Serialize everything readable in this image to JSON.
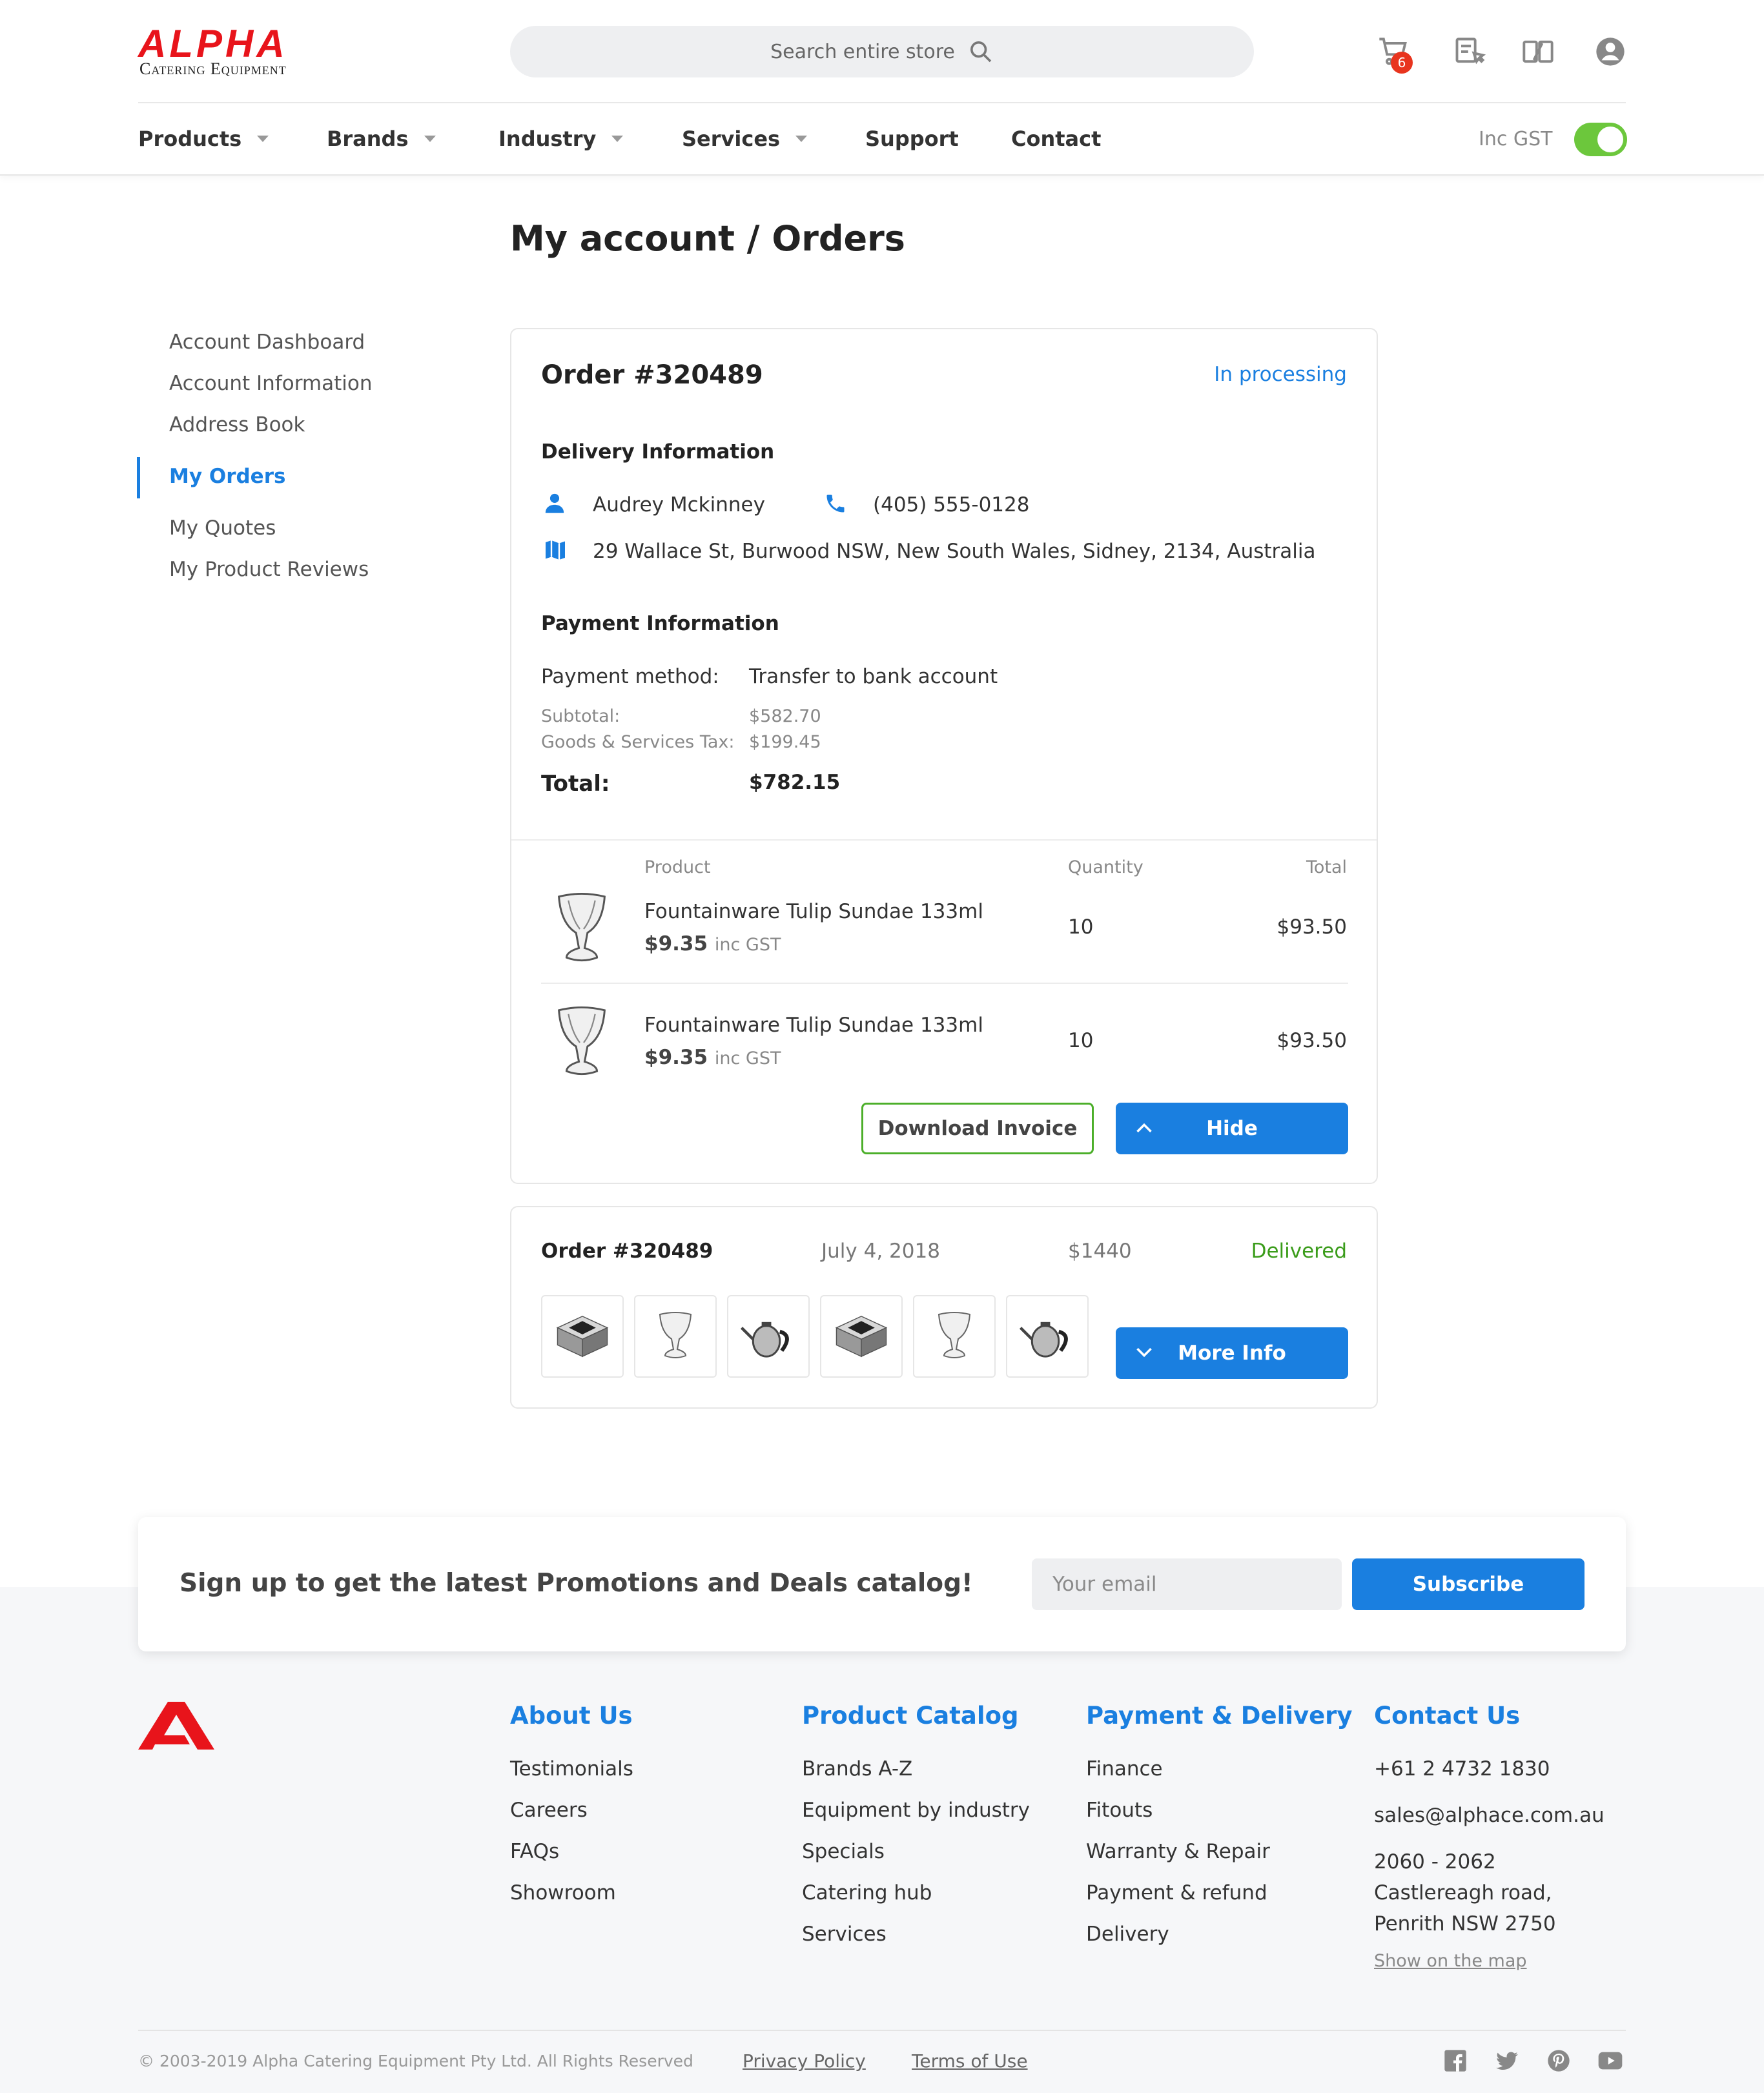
{
  "brand": {
    "name": "ALPHA",
    "tagline": "Catering Equipment",
    "accent": "#e8141b"
  },
  "colors": {
    "primary": "#1a7fe0",
    "success": "#4caf2a",
    "delivered": "#3a9c1a",
    "toggle_on": "#6cc73c"
  },
  "search": {
    "placeholder": "Search entire store"
  },
  "header": {
    "cart_count": "6",
    "icons": [
      "cart-icon",
      "quote-list-icon",
      "compare-icon",
      "user-account-icon"
    ]
  },
  "nav": {
    "items": [
      {
        "label": "Products",
        "dropdown": true
      },
      {
        "label": "Brands",
        "dropdown": true
      },
      {
        "label": "Industry",
        "dropdown": true
      },
      {
        "label": "Services",
        "dropdown": true
      },
      {
        "label": "Support",
        "dropdown": false
      },
      {
        "label": "Contact",
        "dropdown": false
      }
    ],
    "gst_label": "Inc GST",
    "gst_toggle_on": true
  },
  "page": {
    "title": "My account / Orders"
  },
  "sidebar": {
    "items": [
      {
        "label": "Account Dashboard"
      },
      {
        "label": "Account Information"
      },
      {
        "label": "Address Book"
      },
      {
        "label": "My Orders",
        "active": true
      },
      {
        "label": "My Quotes"
      },
      {
        "label": "My Product Reviews"
      }
    ]
  },
  "order_expanded": {
    "title": "Order #320489",
    "status": "In processing",
    "delivery_heading": "Delivery Information",
    "customer_name": "Audrey Mckinney",
    "phone": "(405) 555-0128",
    "address": "29 Wallace St, Burwood NSW, New South Wales, Sidney, 2134, Australia",
    "payment_heading": "Payment Information",
    "payment_method_label": "Payment method:",
    "payment_method": "Transfer to bank account",
    "subtotal_label": "Subtotal:",
    "subtotal": "$582.70",
    "tax_label": "Goods & Services Tax:",
    "tax": "$199.45",
    "total_label": "Total:",
    "total": "$782.15",
    "columns": {
      "product": "Product",
      "quantity": "Quantity",
      "total": "Total"
    },
    "items": [
      {
        "name": "Fountainware Tulip Sundae 133ml",
        "price": "$9.35",
        "price_suffix": "inc GST",
        "quantity": "10",
        "total": "$93.50"
      },
      {
        "name": "Fountainware Tulip Sundae 133ml",
        "price": "$9.35",
        "price_suffix": "inc GST",
        "quantity": "10",
        "total": "$93.50"
      }
    ],
    "download_label": "Download Invoice",
    "hide_label": "Hide"
  },
  "order_collapsed": {
    "title": "Order #320489",
    "date": "July 4, 2018",
    "amount": "$1440",
    "status": "Delivered",
    "thumbnails": [
      "induction-cooker",
      "sundae-glass",
      "teapot",
      "induction-cooker",
      "sundae-glass",
      "teapot"
    ],
    "more_label": "More Info"
  },
  "newsletter": {
    "text": "Sign up to get the latest Promotions and Deals catalog!",
    "placeholder": "Your email",
    "button": "Subscribe"
  },
  "footer": {
    "about": {
      "heading": "About Us",
      "links": [
        "Testimonials",
        "Careers",
        "FAQs",
        "Showroom"
      ]
    },
    "catalog": {
      "heading": "Product Catalog",
      "links": [
        "Brands A-Z",
        "Equipment by industry",
        "Specials",
        "Catering hub",
        "Services"
      ]
    },
    "payment": {
      "heading": "Payment & Delivery",
      "links": [
        "Finance",
        "Fitouts",
        "Warranty & Repair",
        "Payment & refund",
        "Delivery"
      ]
    },
    "contact": {
      "heading": "Contact Us",
      "phone": "+61 2 4732 1830",
      "email": "sales@alphace.com.au",
      "address_line1": "2060 - 2062",
      "address_line2": "Castlereagh road,",
      "address_line3": "Penrith NSW 2750",
      "map_link": "Show on the map"
    },
    "copyright": "© 2003-2019 Alpha Catering Equipment Pty Ltd. All Rights Reserved",
    "privacy": "Privacy Policy",
    "terms": "Terms of Use",
    "social": [
      "facebook-icon",
      "twitter-icon",
      "pinterest-icon",
      "youtube-icon"
    ]
  }
}
